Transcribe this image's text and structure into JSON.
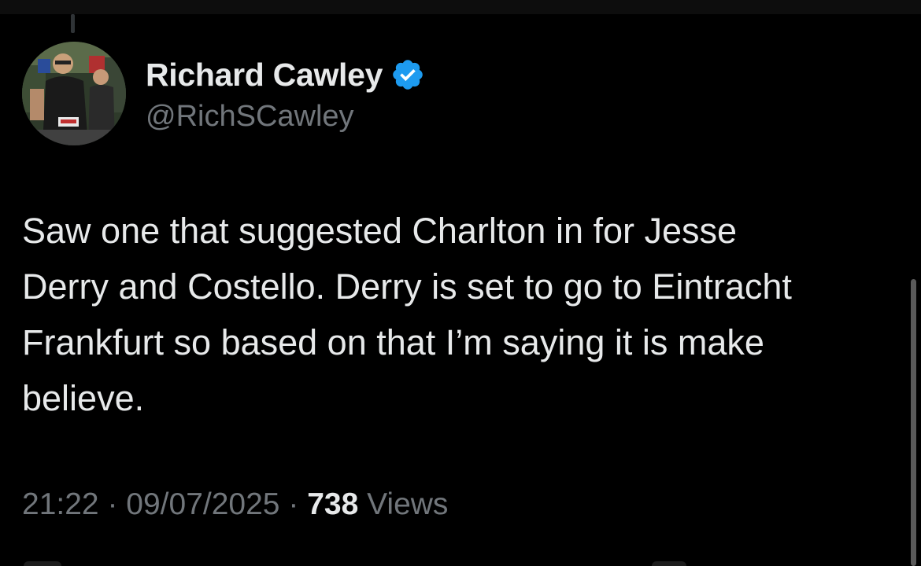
{
  "author": {
    "display_name": "Richard Cawley",
    "handle": "@RichSCawley",
    "verified": true,
    "avatar_icon": "profile-photo-runner"
  },
  "tweet": {
    "text": "Saw one that suggested Charlton in for Jesse\nDerry and Costello. Derry is set to go to Eintracht\nFrankfurt so based on that I’m saying it is make\nbelieve.",
    "time": "21:22",
    "separator": "·",
    "date": "09/07/2025",
    "views_count": "738",
    "views_label": "Views"
  },
  "colors": {
    "background": "#000000",
    "primary_text": "#e7e9ea",
    "secondary_text": "#71767b",
    "verified_blue": "#1d9bf0"
  }
}
